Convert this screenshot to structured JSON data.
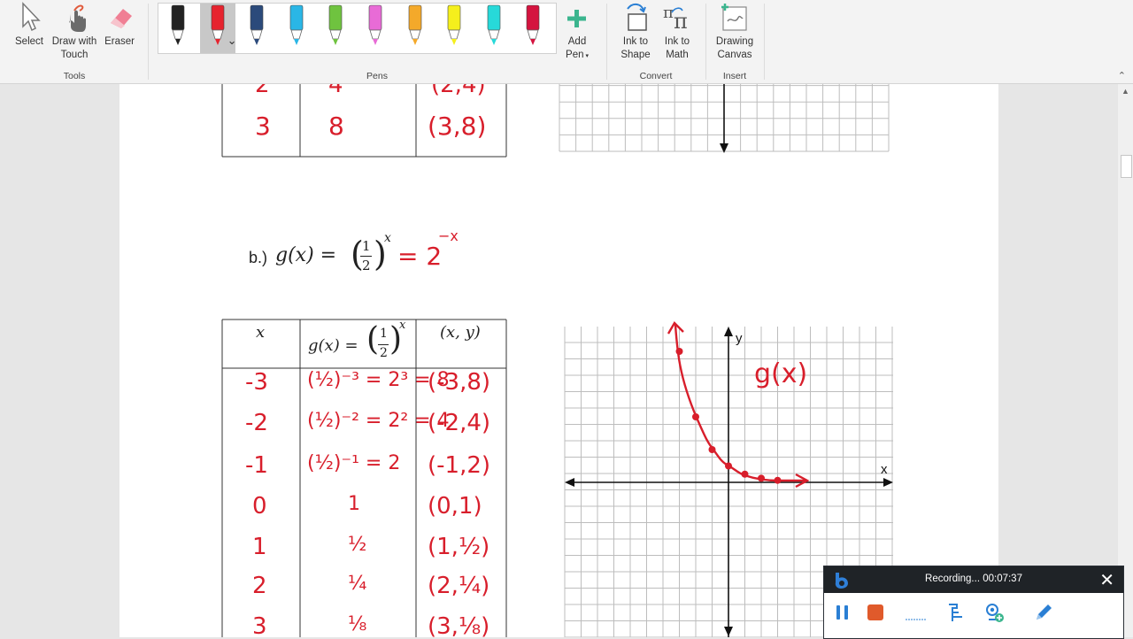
{
  "ribbon": {
    "tools": {
      "select": "Select",
      "draw_touch_1": "Draw with",
      "draw_touch_2": "Touch",
      "eraser": "Eraser",
      "group": "Tools"
    },
    "pens": {
      "group": "Pens",
      "colors": [
        "#222222",
        "#e6232e",
        "#2b4a7b",
        "#2ab6e6",
        "#6fc33f",
        "#e86bd6",
        "#f4a92a",
        "#f5ef1c",
        "#27d9d9",
        "#d4143f"
      ],
      "selected_index": 1,
      "add_pen_1": "Add",
      "add_pen_2": "Pen"
    },
    "convert": {
      "ink_shape_1": "Ink to",
      "ink_shape_2": "Shape",
      "ink_math_1": "Ink to",
      "ink_math_2": "Math",
      "group": "Convert"
    },
    "insert": {
      "canvas_1": "Drawing",
      "canvas_2": "Canvas",
      "group": "Insert"
    }
  },
  "document": {
    "top_table_rows": [
      {
        "x": "2",
        "y": "4",
        "pt": "(2,4)"
      },
      {
        "x": "3",
        "y": "8",
        "pt": "(3,8)"
      }
    ],
    "problem_label": "b.)",
    "problem_func": "g(x) = ",
    "problem_frac_num": "1",
    "problem_frac_den": "2",
    "problem_exp": "x",
    "problem_ink": "= 2",
    "problem_ink_exp": "−x",
    "table_headers": {
      "x": "x",
      "gx": "g(x) = ",
      "gx_num": "1",
      "gx_den": "2",
      "gx_exp": "x",
      "xy": "(x, y)"
    },
    "table_rows": [
      {
        "x": "-3",
        "calc": "(½)⁻³ = 2³ = 8",
        "pt": "(-3,8)"
      },
      {
        "x": "-2",
        "calc": "(½)⁻² = 2² = 4",
        "pt": "(-2,4)"
      },
      {
        "x": "-1",
        "calc": "(½)⁻¹ = 2",
        "pt": "(-1,2)"
      },
      {
        "x": "0",
        "calc": "1",
        "pt": "(0,1)"
      },
      {
        "x": "1",
        "calc": "½",
        "pt": "(1,½)"
      },
      {
        "x": "2",
        "calc": "¼",
        "pt": "(2,¼)"
      },
      {
        "x": "3",
        "calc": "⅛",
        "pt": "(3,⅛)"
      }
    ],
    "graph": {
      "x_label": "x",
      "y_label": "y",
      "curve_label": "g(x)"
    }
  },
  "recorder": {
    "status": "Recording... 00:07:37"
  }
}
